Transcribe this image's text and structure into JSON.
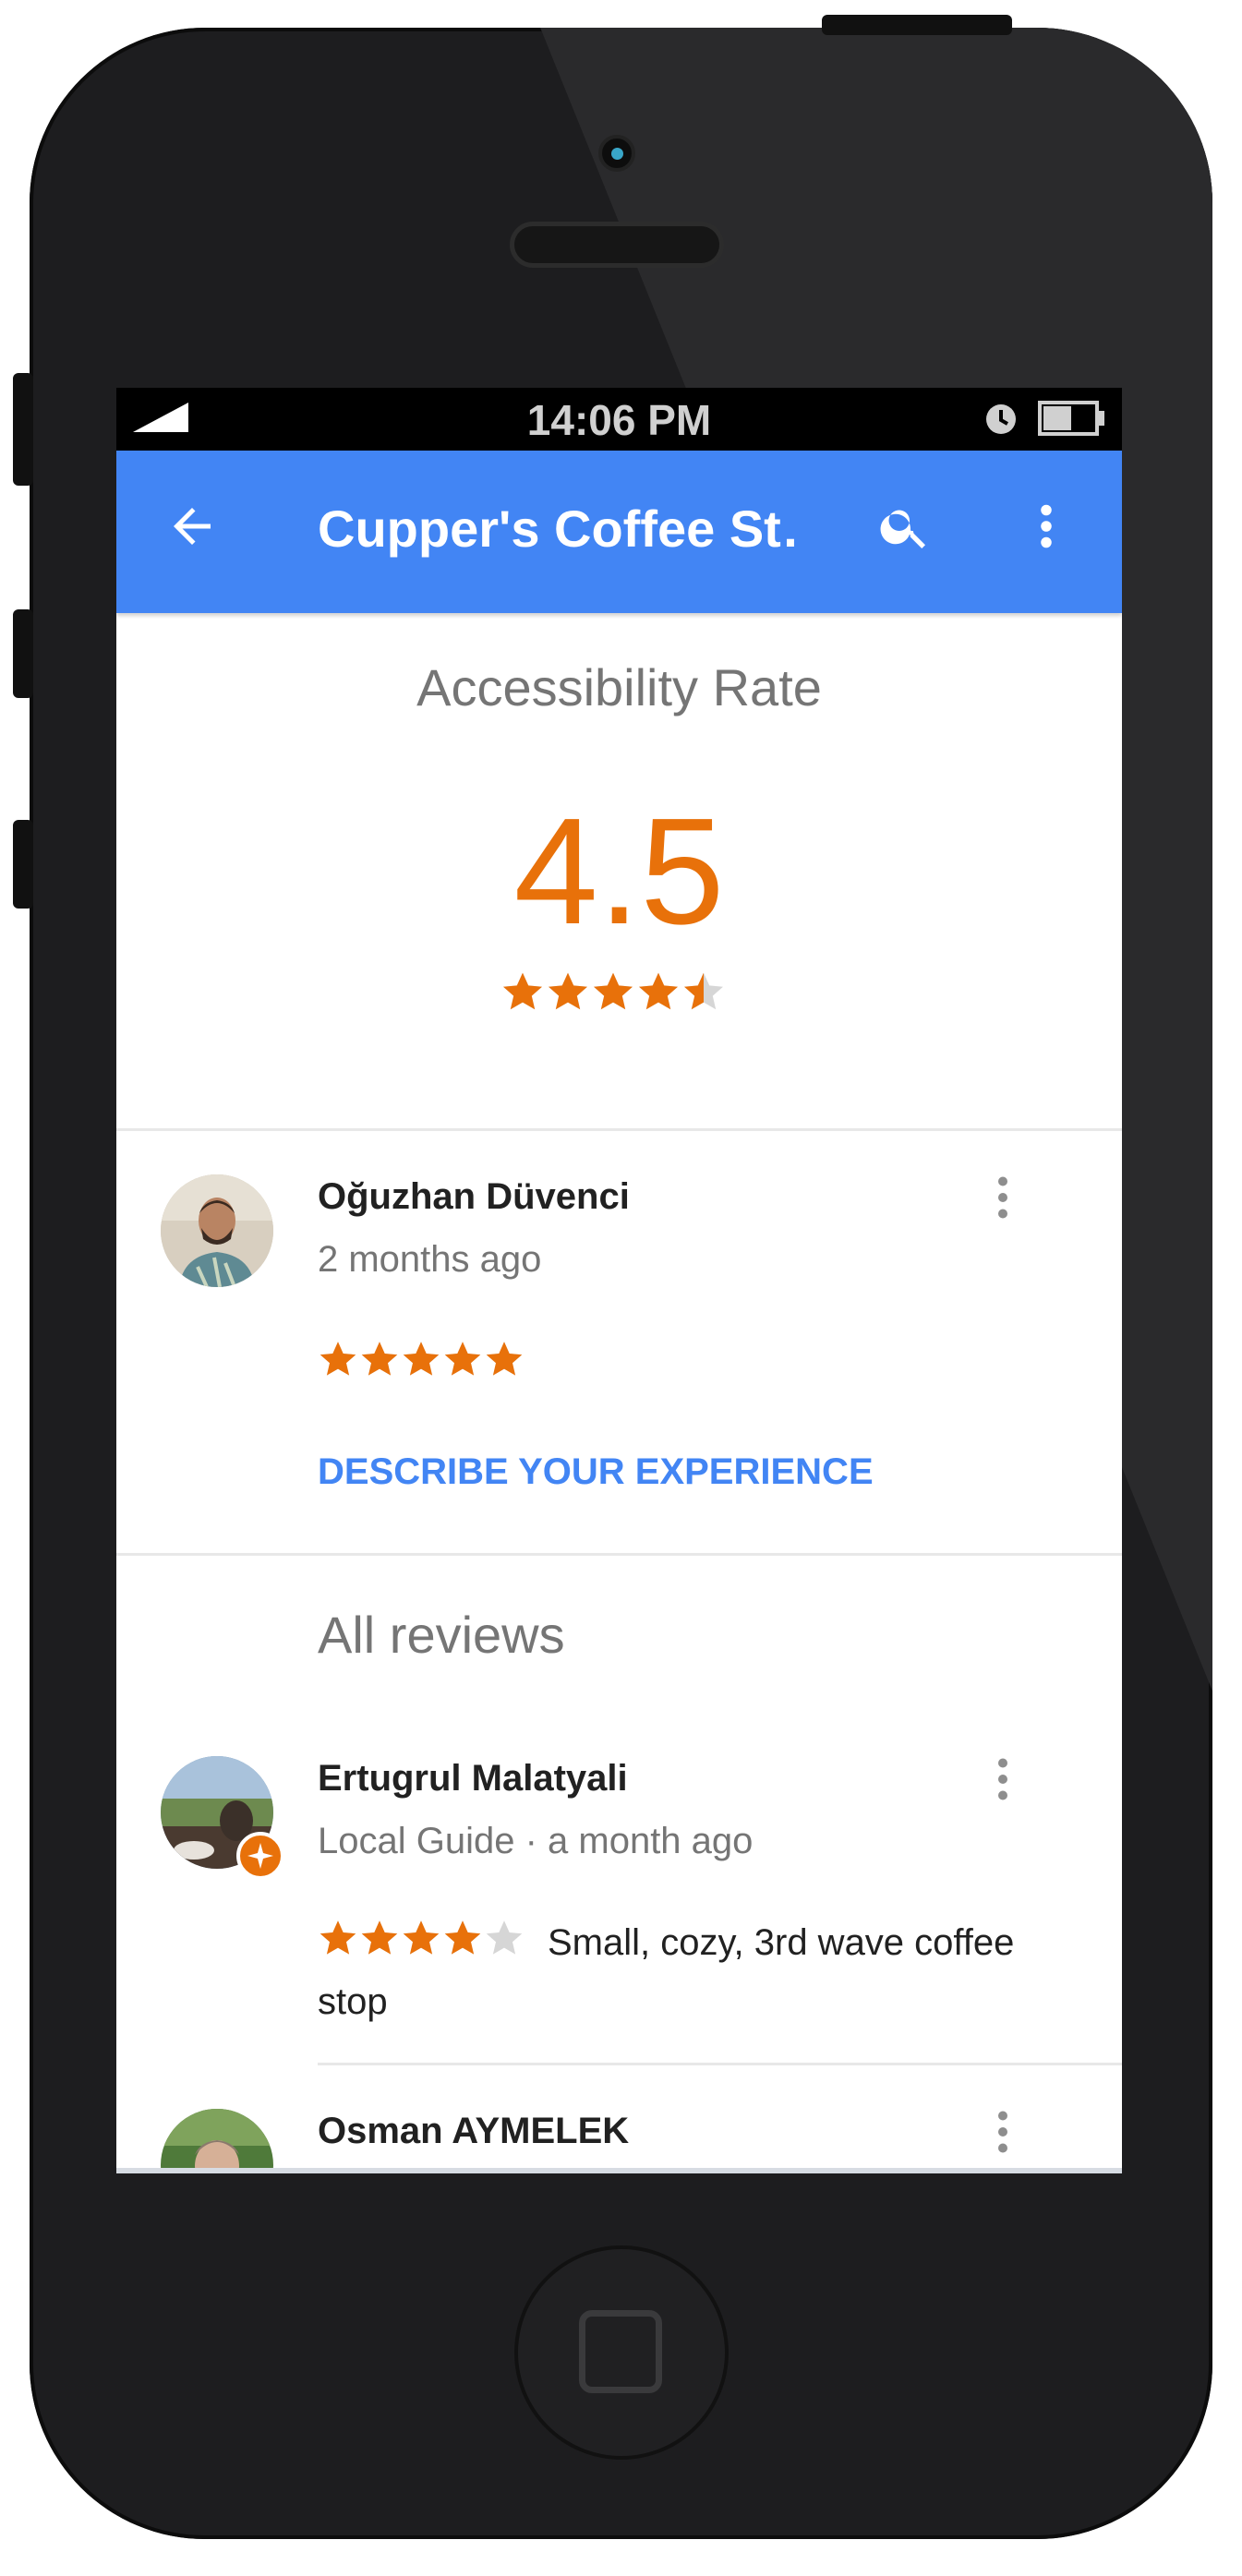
{
  "status_bar": {
    "time": "14:06 PM",
    "icons": [
      "signal-icon",
      "alarm-clock-icon",
      "battery-icon"
    ]
  },
  "app_bar": {
    "title": "Cupper's Coffee St…",
    "icons": [
      "back-arrow-icon",
      "search-icon",
      "more-vert-icon"
    ],
    "color": "#4285f4"
  },
  "accessibility": {
    "title": "Accessibility Rate",
    "rating": "4.5",
    "rating_value": 4.5,
    "star_color": "#e8710a"
  },
  "my_review": {
    "name": "Oğuzhan Düvenci",
    "time": "2 months ago",
    "stars": 5,
    "action_label": "DESCRIBE YOUR EXPERIENCE"
  },
  "all_reviews": {
    "title": "All reviews",
    "reviews": [
      {
        "name": "Ertugrul Malatyali",
        "meta": "Local Guide · a month ago",
        "stars": 4,
        "text": "Small, cozy, 3rd wave coffee stop",
        "badge": "local-guide-badge-icon"
      },
      {
        "name": "Osman AYMELEK"
      }
    ]
  }
}
